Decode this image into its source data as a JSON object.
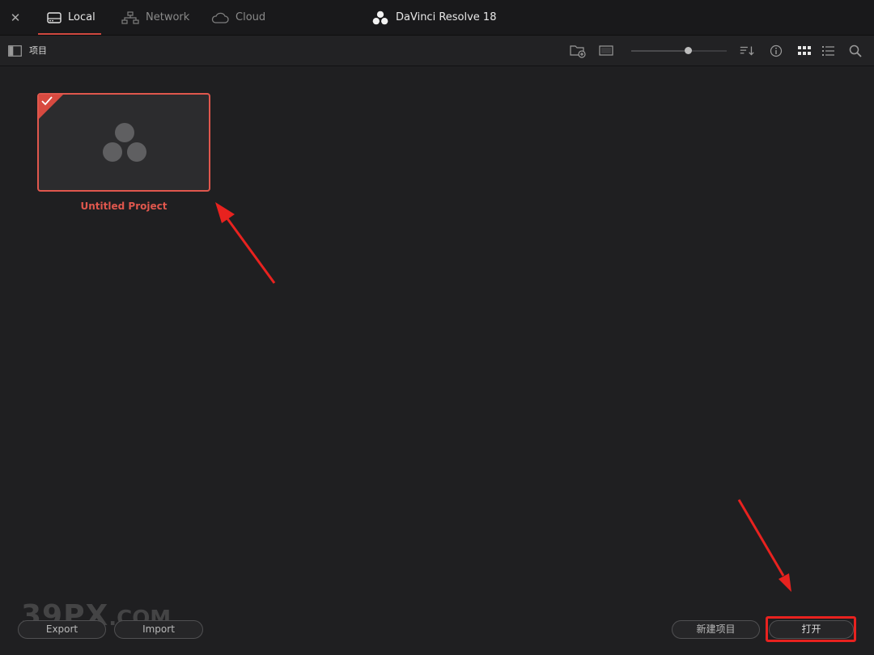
{
  "window": {
    "close_symbol": "✕",
    "app_title": "DaVinci Resolve 18",
    "tabs": [
      {
        "label": "Local",
        "icon": "drive-icon",
        "active": true
      },
      {
        "label": "Network",
        "icon": "network-icon",
        "active": false
      },
      {
        "label": "Cloud",
        "icon": "cloud-icon",
        "active": false
      }
    ]
  },
  "toolbar": {
    "section_label": "项目",
    "icons": [
      "new-folder-icon",
      "thumbnail-view-icon",
      "sort-icon",
      "info-icon",
      "grid-view-icon",
      "list-view-icon",
      "search-icon"
    ],
    "zoom_slider_level": 0.59
  },
  "projects": [
    {
      "name": "Untitled Project",
      "selected": true
    }
  ],
  "footer": {
    "export_label": "Export",
    "import_label": "Import",
    "new_project_label": "新建项目",
    "open_label": "打开"
  },
  "watermark": {
    "main": "39PX",
    "suffix": ".COM"
  },
  "colors": {
    "accent": "#e0574d",
    "annotation_red": "#e8221f",
    "background": "#1f1f21"
  }
}
